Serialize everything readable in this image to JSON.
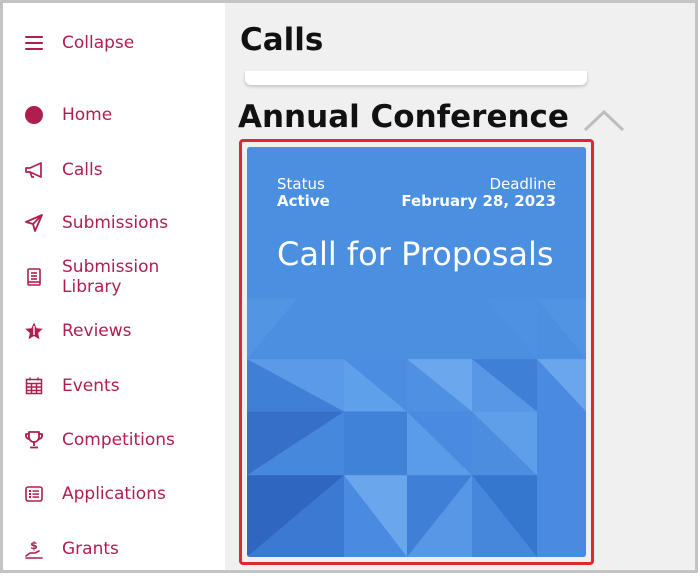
{
  "sidebar": {
    "collapse_label": "Collapse",
    "items": [
      {
        "label": "Home",
        "icon": "home-dot-icon"
      },
      {
        "label": "Calls",
        "icon": "megaphone-icon"
      },
      {
        "label": "Submissions",
        "icon": "paper-plane-icon"
      },
      {
        "label_line1": "Submission",
        "label_line2": "Library",
        "icon": "book-icon"
      },
      {
        "label": "Reviews",
        "icon": "star-icon"
      },
      {
        "label": "Events",
        "icon": "calendar-icon"
      },
      {
        "label": "Competitions",
        "icon": "trophy-icon"
      },
      {
        "label": "Applications",
        "icon": "list-icon"
      },
      {
        "label": "Grants",
        "icon": "hand-coin-icon"
      }
    ],
    "accent_color": "#b01e4f"
  },
  "main": {
    "page_title": "Calls",
    "section_title": "Annual Conference",
    "card": {
      "status_label": "Status",
      "status_value": "Active",
      "deadline_label": "Deadline",
      "deadline_value": "February 28, 2023",
      "title": "Call for Proposals",
      "background_color": "#4a8fe0"
    },
    "highlight_color": "#e0262f"
  }
}
